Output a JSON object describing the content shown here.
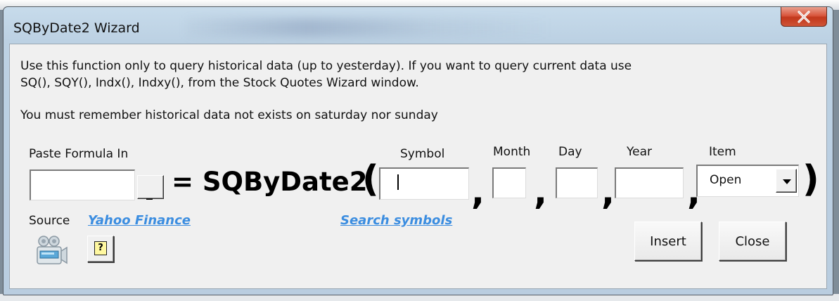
{
  "window": {
    "title": "SQByDate2 Wizard"
  },
  "info": {
    "line1": "Use this function only to query historical data (up to yesterday). If you want to query current data use",
    "line2": "SQ(), SQY(), Indx(), Indxy(), from the Stock Quotes Wizard window.",
    "line3": "You must remember historical data not exists on saturday nor sunday"
  },
  "labels": {
    "paste_formula_in": "Paste Formula In",
    "symbol": "Symbol",
    "month": "Month",
    "day": "Day",
    "year": "Year",
    "item": "Item",
    "source": "Source"
  },
  "formula": {
    "equals_text": "= SQByDate2",
    "open_paren": "(",
    "close_paren": ")",
    "comma": ","
  },
  "fields": {
    "paste_formula_in": "",
    "symbol": "",
    "month": "",
    "day": "",
    "year": "",
    "item_selected": "Open"
  },
  "buttons": {
    "select_range": "_",
    "help": "?",
    "insert": "Insert",
    "close": "Close"
  },
  "links": {
    "yahoo_finance": "Yahoo Finance",
    "search_symbols": "Search symbols"
  },
  "colors": {
    "link": "#3b8de0",
    "close_button": "#c2381d",
    "window_frame": "#bcd1e3",
    "client_bg": "#f0f0f0"
  },
  "icons": {
    "close": "close-x-icon",
    "source": "video-camera-icon",
    "help": "help-question-icon",
    "dropdown": "chevron-down-icon"
  }
}
